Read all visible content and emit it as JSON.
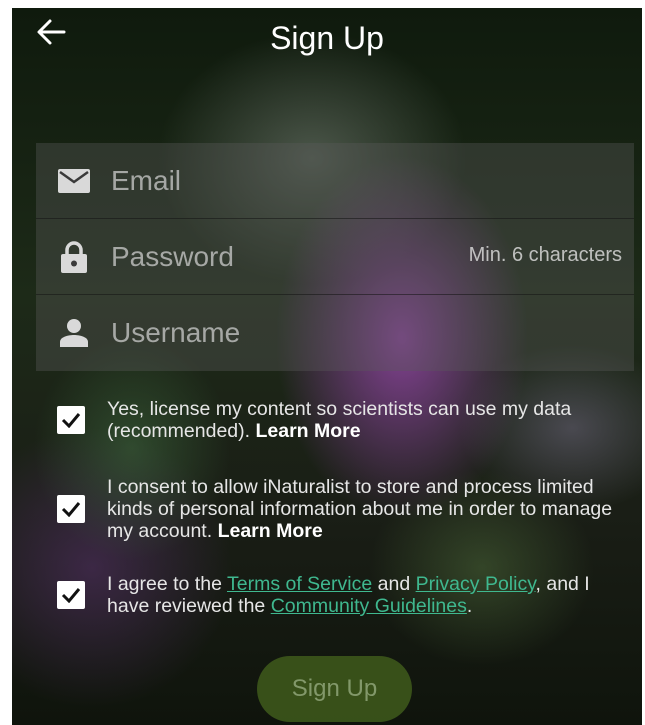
{
  "header": {
    "back_icon": "arrow-left-icon",
    "title": "Sign Up"
  },
  "form": {
    "email": {
      "icon": "envelope-icon",
      "placeholder": "Email",
      "value": ""
    },
    "password": {
      "icon": "lock-icon",
      "placeholder": "Password",
      "value": "",
      "hint": "Min. 6 characters"
    },
    "username": {
      "icon": "person-icon",
      "placeholder": "Username",
      "value": ""
    }
  },
  "consents": {
    "license": {
      "checked": true,
      "text": "Yes, license my content so scientists can use my data (recommended).",
      "link": "Learn More"
    },
    "personal_info": {
      "checked": true,
      "text": "I consent to allow iNaturalist to store and process limited kinds of personal information about me in order to manage my account.",
      "link": "Learn More"
    },
    "terms": {
      "checked": true,
      "text_1": "I agree to the",
      "link_terms": "Terms of Service",
      "text_2": "and",
      "link_privacy": "Privacy Policy",
      "text_3": ", and I have reviewed the",
      "link_guidelines": "Community Guidelines",
      "text_4": "."
    }
  },
  "submit": {
    "label": "Sign Up"
  },
  "colors": {
    "link": "#3fb88f",
    "button_bg": "#46641e",
    "checkbox": "#ffffff"
  }
}
